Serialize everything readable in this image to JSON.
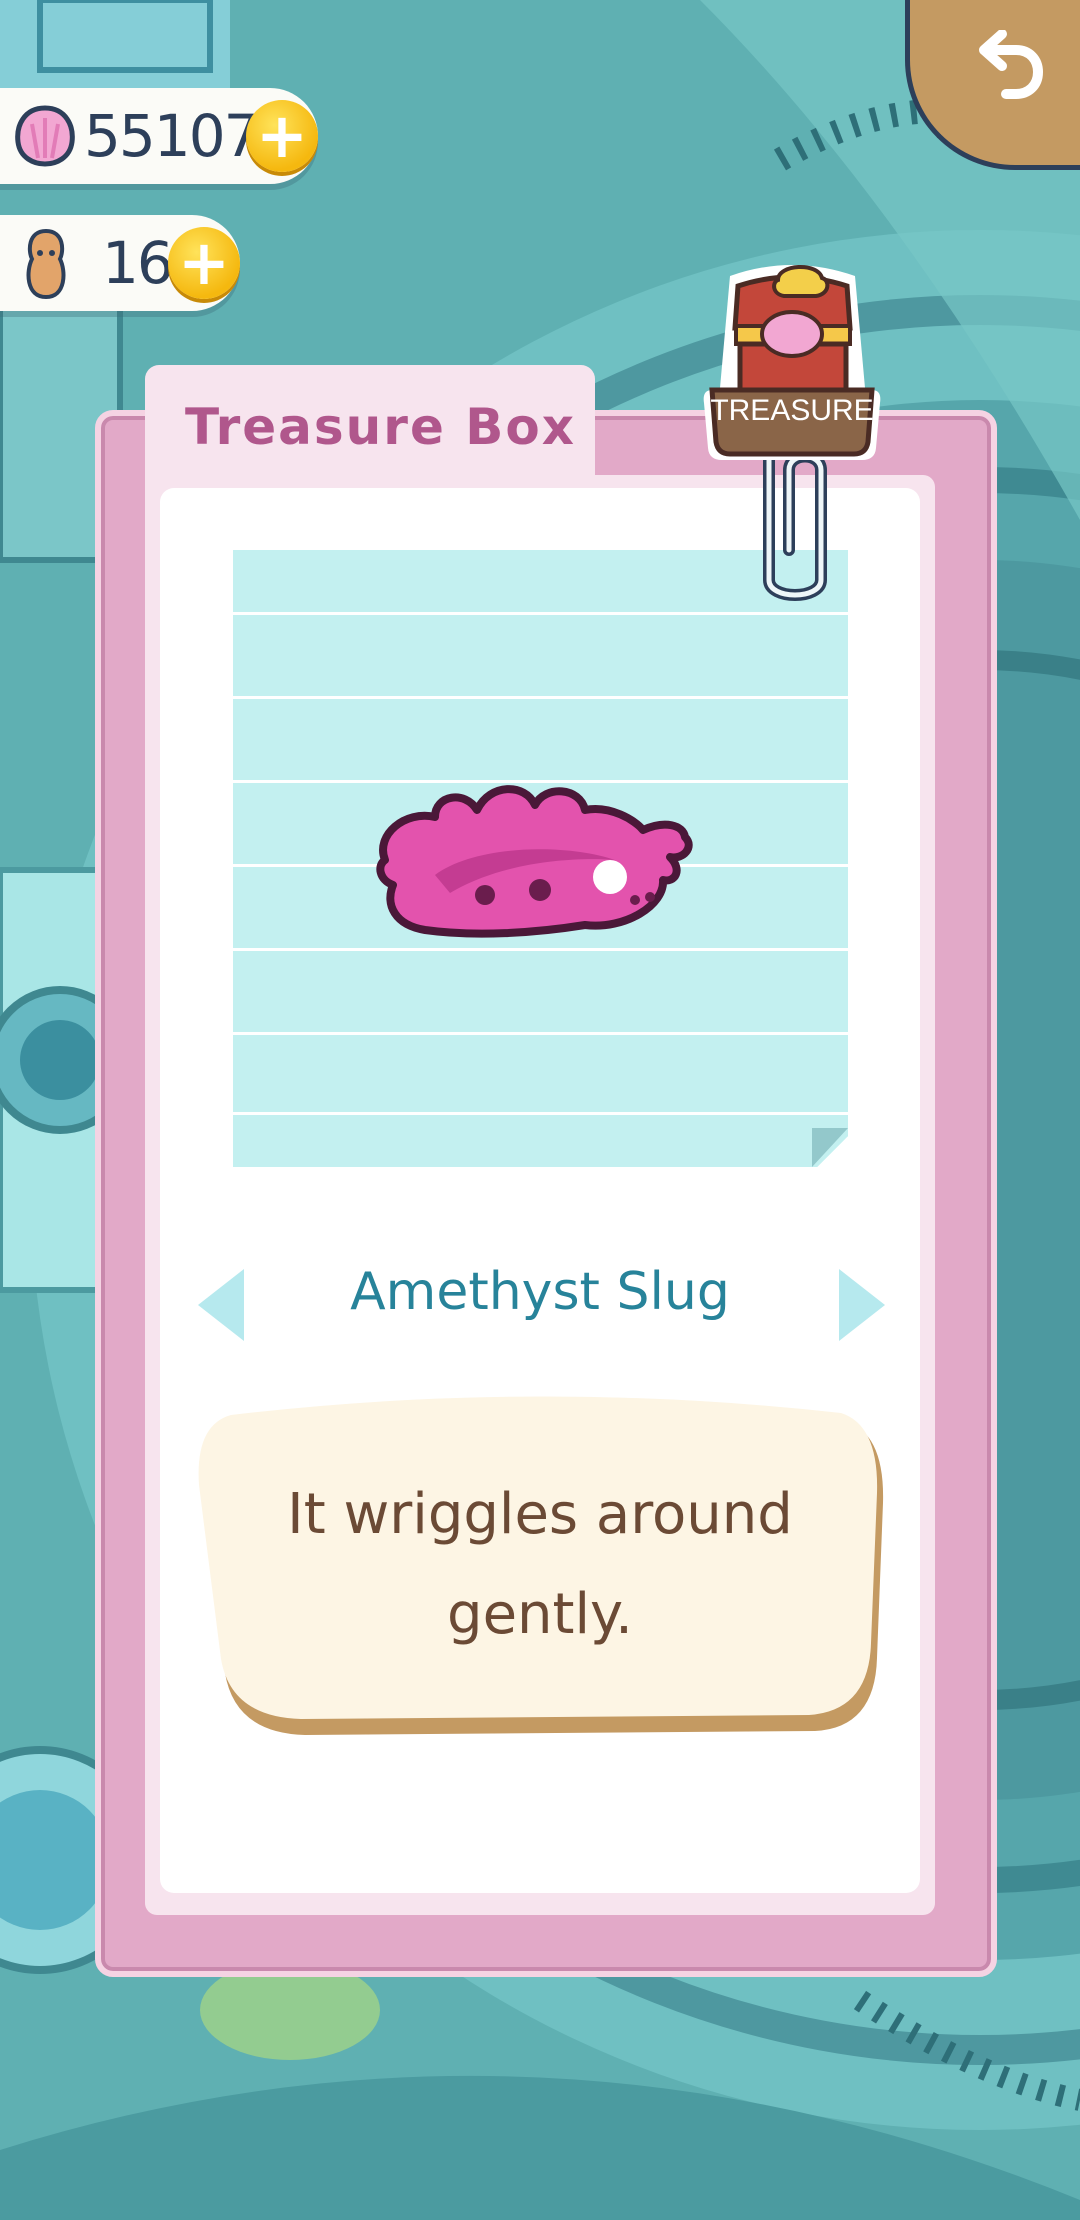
{
  "currency": {
    "shells": "55107",
    "tickets": "16"
  },
  "panel": {
    "tab_title": "Treasure Box",
    "badge_label": "TREASURE"
  },
  "item": {
    "name": "Amethyst Slug",
    "description": "It wriggles around gently."
  },
  "icons": {
    "back": "undo-arrow-icon",
    "shell": "pink-shell-icon",
    "ticket": "peanut-token-icon",
    "add": "plus-icon",
    "prev": "triangle-left-icon",
    "next": "triangle-right-icon"
  },
  "colors": {
    "card": "#e2a9c8",
    "tab_text": "#b0578c",
    "item_name": "#27839a",
    "description_text": "#6b4a35",
    "coin": "#f5b80f"
  }
}
